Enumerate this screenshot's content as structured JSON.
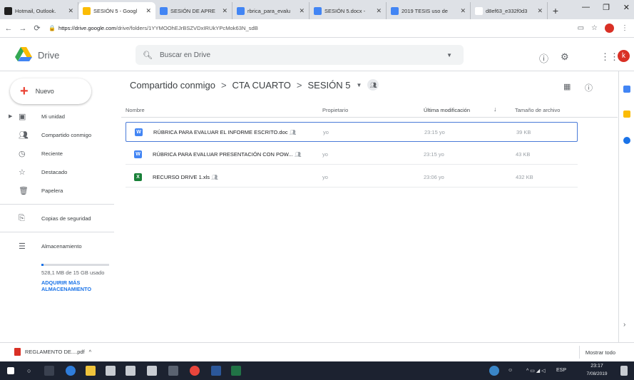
{
  "browser": {
    "tabs": [
      {
        "title": "Hotmail, Outlook.",
        "color": "#1f1f1f"
      },
      {
        "title": "SESIÓN 5 - Googl",
        "color": "#fbbc04",
        "active": true
      },
      {
        "title": "SESIÓN DE APRE",
        "color": "#4285f4"
      },
      {
        "title": "rbrica_para_evalu",
        "color": "#4285f4"
      },
      {
        "title": "SESIÓN 5.docx -",
        "color": "#4285f4"
      },
      {
        "title": "2019 TESIS uso de",
        "color": "#4285f4"
      },
      {
        "title": "d8ef63_e332f0d3",
        "color": "#ffffff"
      }
    ],
    "url_host": "https://drive.google.com",
    "url_path": "/drive/folders/1YYMOOhEJrBSZVDxIRUkYPcMok63N_sdB"
  },
  "drive": {
    "brand": "Drive",
    "search_placeholder": "Buscar en Drive",
    "avatar_letter": "k"
  },
  "sidebar": {
    "new_label": "Nuevo",
    "items": [
      {
        "label": "Mi unidad",
        "icon": "drive-icon"
      },
      {
        "label": "Compartido conmigo",
        "icon": "people-icon"
      },
      {
        "label": "Reciente",
        "icon": "clock-icon"
      },
      {
        "label": "Destacado",
        "icon": "star-icon"
      },
      {
        "label": "Papelera",
        "icon": "trash-icon"
      },
      {
        "label": "Copias de seguridad",
        "icon": "backup-icon"
      },
      {
        "label": "Almacenamiento",
        "icon": "storage-icon"
      }
    ],
    "storage_used": "528,1 MB de 15 GB usado",
    "storage_fraction": 0.034,
    "buy_storage": "ADQUIRIR MÁS ALMACENAMIENTO"
  },
  "breadcrumb": {
    "root": "Compartido conmigo",
    "parent": "CTA CUARTO",
    "current": "SESIÓN 5"
  },
  "columns": {
    "name": "Nombre",
    "owner": "Propietario",
    "modified": "Última modificación",
    "size": "Tamaño de archivo"
  },
  "files": [
    {
      "name": "RÚBRICA PARA EVALUAR EL INFORME ESCRITO.doc",
      "type": "W",
      "color": "#4285f4",
      "owner": "yo",
      "modified": "23:15 yo",
      "size": "39 KB",
      "selected": true
    },
    {
      "name": "RÚBRICA PARA EVALUAR PRESENTACIÓN CON POW...",
      "type": "W",
      "color": "#4285f4",
      "owner": "yo",
      "modified": "23:15 yo",
      "size": "43 KB",
      "selected": false
    },
    {
      "name": "RECURSO DRIVE 1.xls",
      "type": "X",
      "color": "#188038",
      "owner": "yo",
      "modified": "23:06 yo",
      "size": "432 KB",
      "selected": false
    }
  ],
  "downloads": {
    "file": "REGLAMENTO DE....pdf",
    "show_all": "Mostrar todo"
  },
  "taskbar": {
    "lang": "ESP",
    "time": "23:17",
    "date": "7/08/2019"
  }
}
